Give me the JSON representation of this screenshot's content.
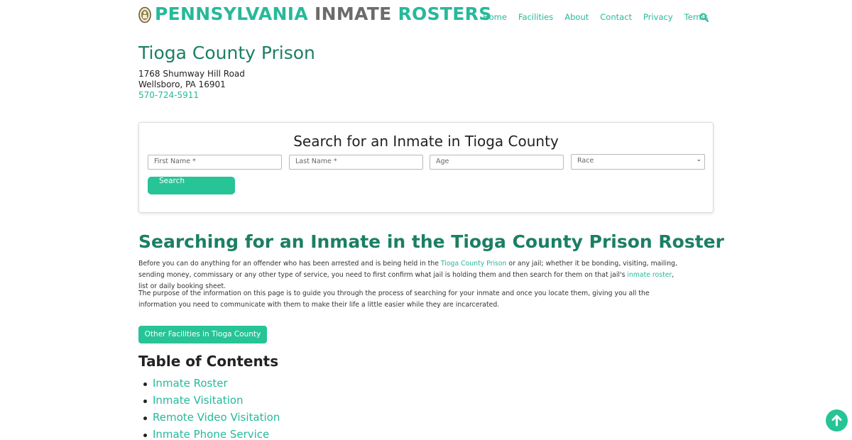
{
  "header": {
    "title_word1": "PENNSYLVANIA",
    "title_word2": "INMATE",
    "title_word3": "ROSTERS",
    "logo_icon": "county-seal-icon",
    "nav": [
      "Home",
      "Facilities",
      "About",
      "Contact",
      "Privacy",
      "Terms"
    ],
    "search_icon": "search-icon"
  },
  "facility": {
    "name": "Tioga County Prison",
    "address_line1": "1768 Shumway Hill Road",
    "address_line2": "Wellsboro, PA 16901",
    "phone": "570-724-5911"
  },
  "search": {
    "title": "Search for an Inmate in Tioga County",
    "first_name_placeholder": "First Name *",
    "last_name_placeholder": "Last Name *",
    "age_placeholder": "Age",
    "race_selected": "Race",
    "button": "Search"
  },
  "article": {
    "heading": "Searching for an Inmate in the Tioga County Prison Roster",
    "p1_a": "Before you can do anything for an offender who has been arrested and is being held in the ",
    "p1_link1": "Tioga County Prison",
    "p1_b": " or any jail; whether it be bonding, visiting, mailing, sending money, commissary or any other type of service, you need to first confirm what jail is holding them and then search for them on that jail's ",
    "p1_link2": "inmate roster",
    "p1_c": ", list or daily booking sheet.",
    "p2": "The purpose of the information on this page is to guide you through the process of searching for your inmate and once you locate them, giving you all the information you need to communicate with them to make their life a little easier while they are incarcerated.",
    "other_button": "Other Facilities in Tioga County"
  },
  "toc": {
    "title": "Table of Contents",
    "items": [
      "Inmate Roster",
      "Inmate Visitation",
      "Remote Video Visitation",
      "Inmate Phone Service"
    ]
  },
  "back_to_top_icon": "arrow-up-icon",
  "colors": {
    "accent": "#26b99a",
    "button": "#26c496",
    "heading": "#1b7f64"
  }
}
